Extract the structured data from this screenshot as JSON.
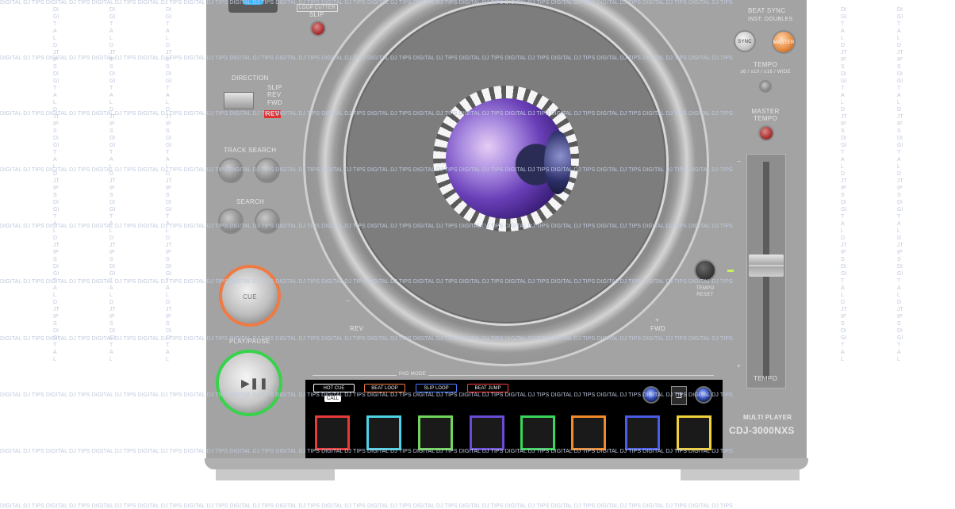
{
  "watermark": {
    "text": "DIGITAL DJ TIPS DIGITAL DJ TIPS DIGITAL DJ TIPS DIGITAL DJ TIPS DIGITAL DJ TIPS DIGITAL DJ TIPS DIGITAL DJ TIPS DIGITAL DJ TIPS DIGITAL DJ TIPS DIGITAL DJ TIPS DIGITAL DJ TIPS DIGITAL DJ TIPS DIGITAL DJ TIPS DIGITAL DJ TIPS DIGITAL DJ TIPS DIGITAL DJ TIPS",
    "col": "DIGITALDJTIPSDIGITALDJTIPSDIGITALDJTIPSDIGITALDJTIPSDIGITALDJTIPSDIGITAL"
  },
  "top": {
    "loop_cutter": "LOOP CUTTER",
    "slip": "SLIP"
  },
  "left": {
    "direction": "DIRECTION",
    "slip_rev": "SLIP REV",
    "fwd": "FWD",
    "rev_label": "REV",
    "track_search": "TRACK SEARCH",
    "search": "SEARCH",
    "cue": "CUE",
    "play_pause": "PLAY/PAUSE"
  },
  "jog": {
    "rev": "REV",
    "fwd": "FWD",
    "minus": "−",
    "plus": "+"
  },
  "right": {
    "beat_sync": "BEAT SYNC",
    "inst_doubles": "INST. DOUBLES",
    "sync": "SYNC",
    "master": "MASTER",
    "tempo_range": "TEMPO",
    "tempo_range_values": "±6 / ±10 / ±16 / WIDE",
    "master_tempo": "MASTER TEMPO",
    "tempo_reset": "TEMPO RESET",
    "tempo": "TEMPO",
    "minus": "−",
    "plus": "+",
    "player_type": "MULTI PLAYER",
    "model": "CDJ-3000NXS"
  },
  "pad_mode": {
    "label": "PAD MODE",
    "modes": [
      {
        "label": "HOT CUE",
        "color": "#ffffff"
      },
      {
        "label": "BEAT LOOP",
        "color": "#f07a43"
      },
      {
        "label": "SLIP LOOP",
        "color": "#4a7bff"
      },
      {
        "label": "BEAT JUMP",
        "color": "#ff3b3b"
      }
    ],
    "call": "CALL"
  },
  "pads": [
    {
      "color": "#e83a3a"
    },
    {
      "color": "#4fd2e6"
    },
    {
      "color": "#6fd65a"
    },
    {
      "color": "#6a4bd6"
    },
    {
      "color": "#3ad65a"
    },
    {
      "color": "#f08a2a"
    },
    {
      "color": "#4a5be6"
    },
    {
      "color": "#f0d23a"
    }
  ]
}
